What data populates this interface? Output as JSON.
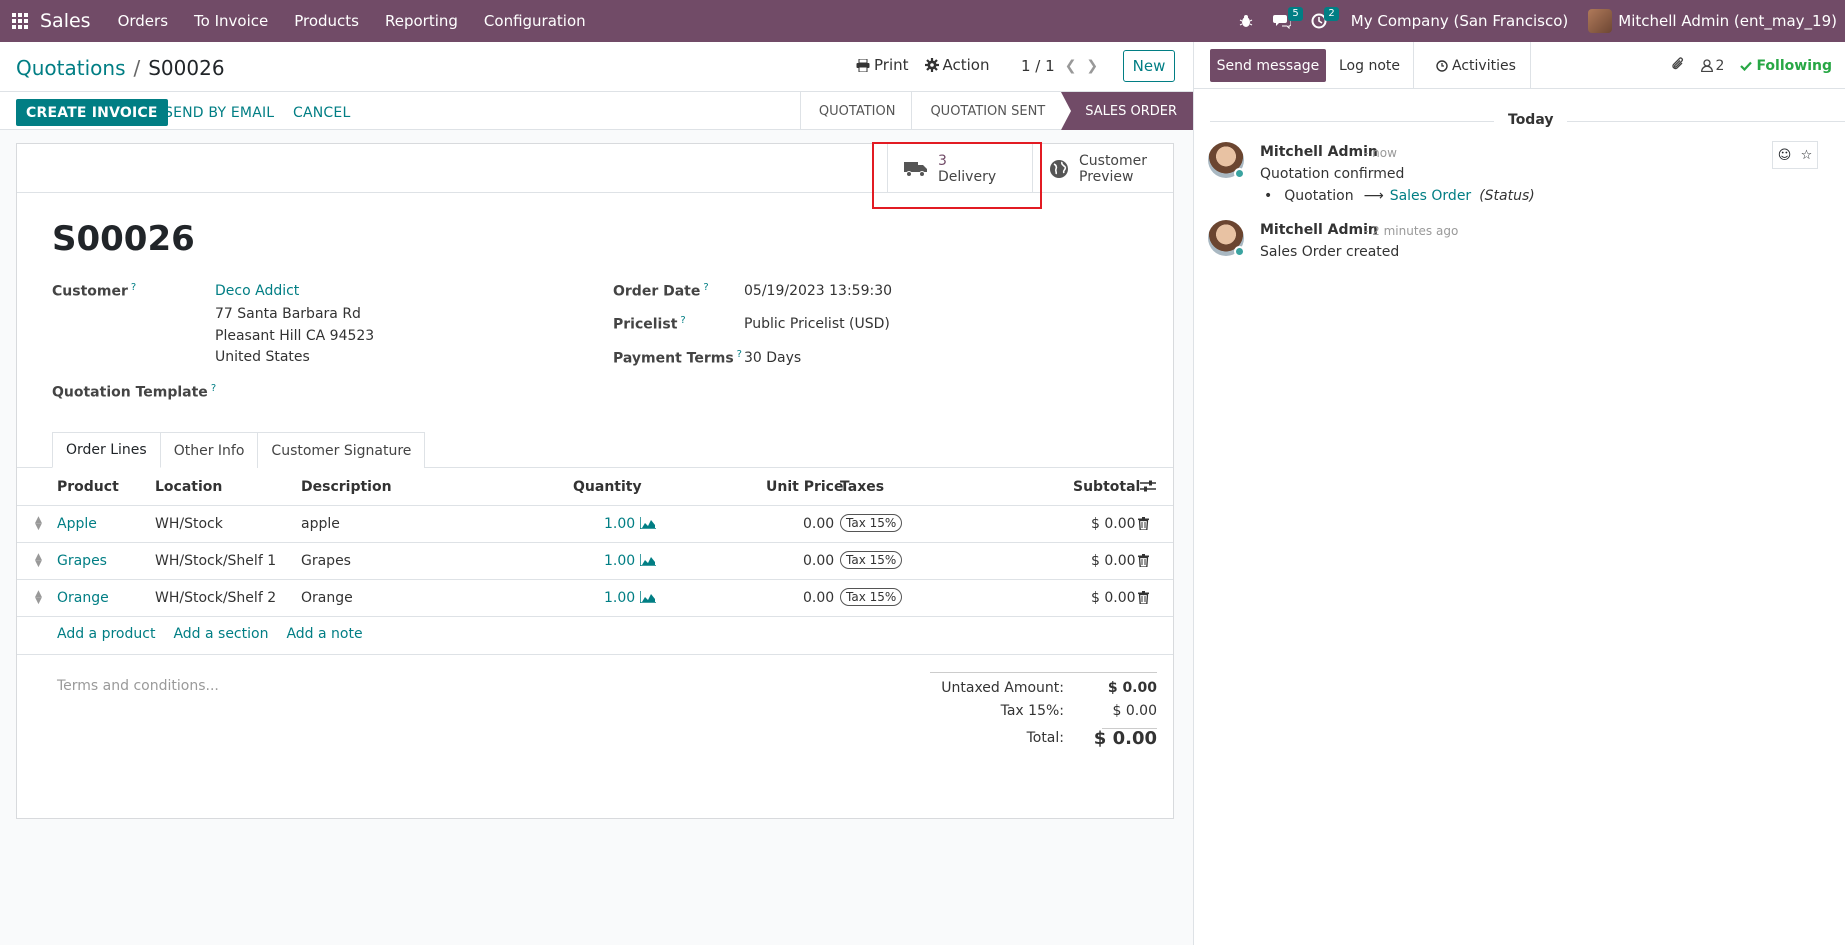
{
  "navbar": {
    "app_name": "Sales",
    "menu": [
      "Orders",
      "To Invoice",
      "Products",
      "Reporting",
      "Configuration"
    ],
    "messages_count": "5",
    "activities_count": "2",
    "company": "My Company (San Francisco)",
    "user": "Mitchell Admin (ent_may_19)"
  },
  "control": {
    "breadcrumb_parent": "Quotations",
    "breadcrumb_current": "S00026",
    "print_label": "Print",
    "action_label": "Action",
    "pager": "1 / 1",
    "new_label": "New",
    "buttons": {
      "create_invoice": "CREATE INVOICE",
      "send_email": "SEND BY EMAIL",
      "cancel": "CANCEL"
    },
    "stages": [
      "QUOTATION",
      "QUOTATION SENT",
      "SALES ORDER"
    ],
    "active_stage": "SALES ORDER"
  },
  "smart_buttons": {
    "delivery_count": "3",
    "delivery_label": "Delivery",
    "preview_line1": "Customer",
    "preview_line2": "Preview"
  },
  "form": {
    "name": "S00026",
    "customer_label": "Customer",
    "customer_name": "Deco Addict",
    "customer_address1": "77 Santa Barbara Rd",
    "customer_address2": "Pleasant Hill CA 94523",
    "customer_country": "United States",
    "template_label": "Quotation Template",
    "order_date_label": "Order Date",
    "order_date": "05/19/2023 13:59:30",
    "pricelist_label": "Pricelist",
    "pricelist": "Public Pricelist (USD)",
    "payment_terms_label": "Payment Terms",
    "payment_terms": "30 Days"
  },
  "tabs": [
    "Order Lines",
    "Other Info",
    "Customer Signature"
  ],
  "lines": {
    "headers": {
      "product": "Product",
      "location": "Location",
      "description": "Description",
      "quantity": "Quantity",
      "unit_price": "Unit Price",
      "taxes": "Taxes",
      "subtotal": "Subtotal"
    },
    "rows": [
      {
        "product": "Apple",
        "location": "WH/Stock",
        "description": "apple",
        "quantity": "1.00",
        "unit_price": "0.00",
        "tax": "Tax 15%",
        "subtotal": "$ 0.00"
      },
      {
        "product": "Grapes",
        "location": "WH/Stock/Shelf 1",
        "description": "Grapes",
        "quantity": "1.00",
        "unit_price": "0.00",
        "tax": "Tax 15%",
        "subtotal": "$ 0.00"
      },
      {
        "product": "Orange",
        "location": "WH/Stock/Shelf 2",
        "description": "Orange",
        "quantity": "1.00",
        "unit_price": "0.00",
        "tax": "Tax 15%",
        "subtotal": "$ 0.00"
      }
    ],
    "add_product": "Add a product",
    "add_section": "Add a section",
    "add_note": "Add a note"
  },
  "footer": {
    "terms_placeholder": "Terms and conditions...",
    "untaxed_label": "Untaxed Amount:",
    "untaxed_value": "$ 0.00",
    "tax_label": "Tax 15%:",
    "tax_value": "$ 0.00",
    "total_label": "Total:",
    "total_value": "$ 0.00"
  },
  "chatter": {
    "send_message": "Send message",
    "log_note": "Log note",
    "activities": "Activities",
    "followers_count": "2",
    "following": "Following",
    "today": "Today",
    "messages": [
      {
        "author": "Mitchell Admin",
        "time": "- now",
        "text": "Quotation confirmed",
        "change_from": "Quotation",
        "change_to": "Sales Order",
        "change_field": "(Status)"
      },
      {
        "author": "Mitchell Admin",
        "time": "- 2 minutes ago",
        "text": "Sales Order created"
      }
    ]
  },
  "colors": {
    "brand": "#714B67",
    "accent": "#017e84",
    "highlight": "#e21b23"
  }
}
